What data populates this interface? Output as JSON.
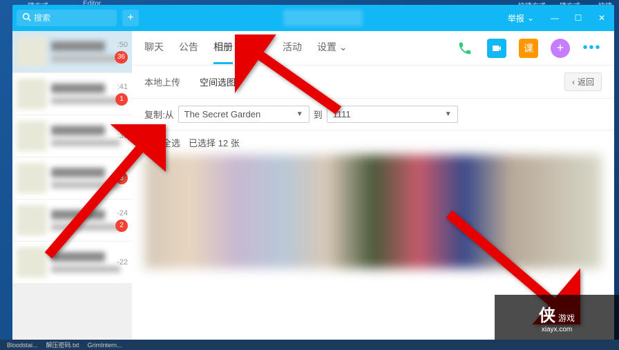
{
  "desktop": {
    "top_items": [
      "捷方式",
      "Editor",
      "快捷方式",
      "捷方式",
      "- 快捷"
    ],
    "taskbar_items": [
      "Bloodstai...",
      "解压密码.txt",
      "GrimIntern..."
    ]
  },
  "titlebar": {
    "search_placeholder": "搜索",
    "report_label": "举报"
  },
  "sidebar": {
    "items": [
      {
        "time": ":50",
        "badge": "36"
      },
      {
        "time": ":41",
        "badge": "1"
      },
      {
        "time": ":36",
        "badge": ""
      },
      {
        "time": "",
        "badge": "3"
      },
      {
        "time": "-24",
        "badge": "2"
      },
      {
        "time": "-22",
        "badge": ""
      }
    ]
  },
  "tabs": {
    "items": [
      "聊天",
      "公告",
      "相册",
      "文件",
      "活动",
      "设置"
    ],
    "active_index": 2
  },
  "header_icons": {
    "class_label": "课"
  },
  "subtabs": {
    "items": [
      "本地上传",
      "空间选图"
    ],
    "active_index": 1,
    "back_label": "返回"
  },
  "copy_row": {
    "copy_from_label": "复制:从",
    "source_value": "The Secret Garden",
    "to_label": "到",
    "dest_value": "1111"
  },
  "select_row": {
    "all_label": "全选",
    "selected_label": "已选择 12 张"
  },
  "watermark": {
    "brand": "侠",
    "text1": "游戏",
    "text2": "xiayx.com"
  }
}
